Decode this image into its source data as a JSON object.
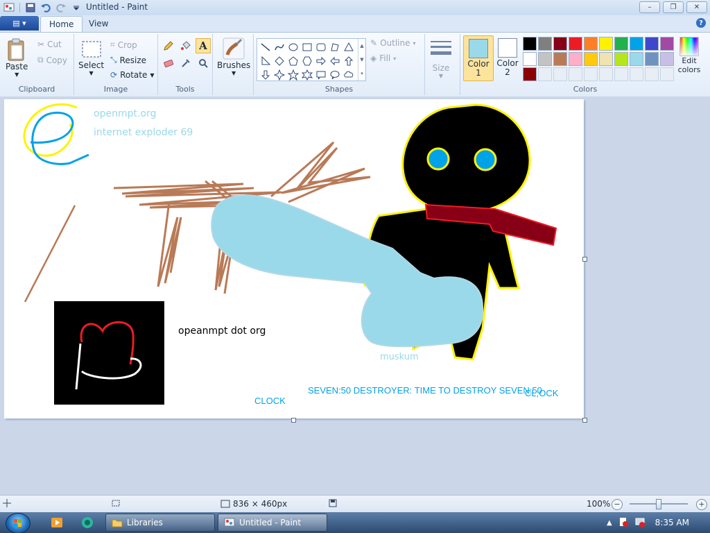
{
  "window": {
    "title": "Untitled - Paint",
    "controls": {
      "minimize": "–",
      "maximize": "❐",
      "close": "✕"
    }
  },
  "ribbon_tabs": {
    "menu": "▤ ▾",
    "home": "Home",
    "view": "View",
    "help": "?"
  },
  "clipboard": {
    "paste": "Paste",
    "cut": "Cut",
    "copy": "Copy",
    "label": "Clipboard"
  },
  "image": {
    "select": "Select",
    "crop": "Crop",
    "resize": "Resize",
    "rotate": "Rotate",
    "label": "Image"
  },
  "tools": {
    "label": "Tools"
  },
  "brushes": {
    "label": "Brushes"
  },
  "shapes": {
    "outline": "Outline",
    "fill": "Fill",
    "label": "Shapes"
  },
  "size": {
    "label": "Size"
  },
  "colors": {
    "color1": "Color 1",
    "color1_value": "#99d9ea",
    "color2": "Color 2",
    "color2_value": "#ffffff",
    "edit": "Edit colors",
    "label": "Colors",
    "palette": [
      "#000000",
      "#7f7f7f",
      "#880015",
      "#ed1c24",
      "#ff7f27",
      "#fff200",
      "#22b14c",
      "#00a2e8",
      "#3f48cc",
      "#a349a4",
      "#ffffff",
      "#c3c3c3",
      "#b97a57",
      "#ffaec9",
      "#ffc90e",
      "#efe4b0",
      "#b5e61d",
      "#99d9ea",
      "#7092be",
      "#c8bfe7",
      "#8b0000",
      "",
      "",
      "",
      "",
      "",
      "",
      "",
      "",
      ""
    ]
  },
  "canvas_texts": {
    "t1": "openmpt.org",
    "t2": "internet exploder 69",
    "t3": "opeanmpt dot org",
    "t4": "muskum",
    "t5": "CLOCK",
    "t6": "SEVEN:50 DESTROYER: TIME TO DESTROY SEVEN:50",
    "t7": "CL;OCK"
  },
  "status": {
    "dimensions": "836 × 460px",
    "zoom": "100%",
    "zoom_fraction": 0.5
  },
  "taskbar": {
    "libraries": "Libraries",
    "paint": "Untitled - Paint",
    "time": "8:35 AM"
  }
}
